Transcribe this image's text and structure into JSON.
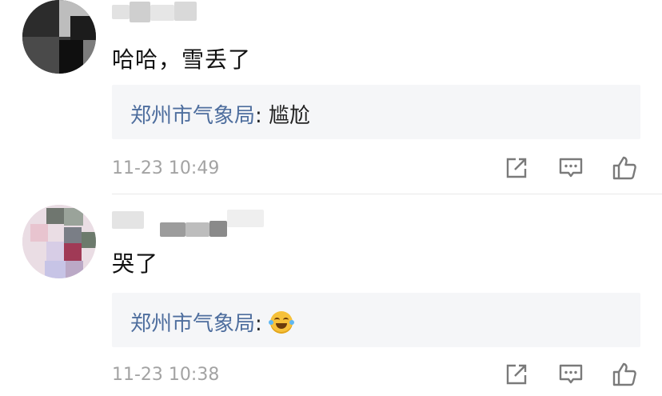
{
  "comments": [
    {
      "text": "哈哈，雪丢了",
      "reply": {
        "author": "郑州市气象局",
        "separator": ": ",
        "text": "尴尬",
        "emoji": ""
      },
      "timestamp": "11-23 10:49"
    },
    {
      "text": "哭了",
      "reply": {
        "author": "郑州市气象局",
        "separator": ": ",
        "text": "",
        "emoji": "laugh-cry-emoji"
      },
      "timestamp": "11-23 10:38"
    }
  ],
  "icons": {
    "share": "share-icon",
    "comment": "comment-icon",
    "like": "thumbs-up-icon"
  },
  "colors": {
    "reply_author": "#4e6e9e",
    "reply_background": "#f5f6f8",
    "timestamp": "#a3a3a3",
    "icon": "#7a7a7a"
  }
}
